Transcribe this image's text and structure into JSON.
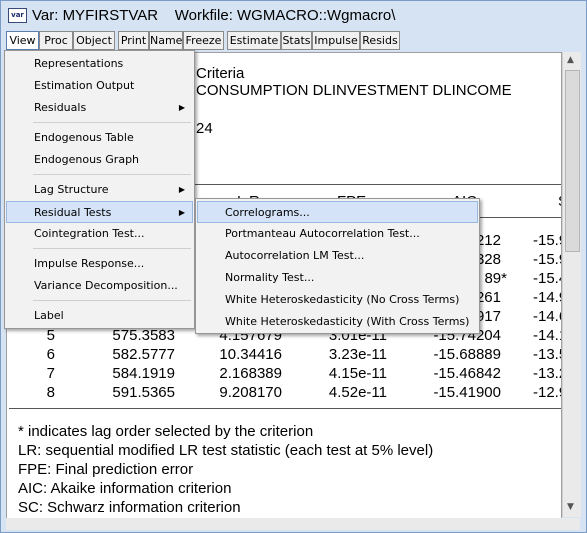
{
  "window": {
    "title": "Var: MYFIRSTVAR    Workfile: WGMACRO::Wgmacro\\",
    "icon_text": "var"
  },
  "toolbar": [
    "View",
    "Proc",
    "Object",
    "Print",
    "Name",
    "Freeze",
    "Estimate",
    "Stats",
    "Impulse",
    "Resids"
  ],
  "content": {
    "partial_lines": [
      "Criteria",
      "CONSUMPTION DLINVESTMENT DLINCOME",
      "24"
    ],
    "header_partial": [
      "L R",
      "FPE",
      "AIC",
      "S"
    ],
    "rows": [
      {
        "lag": "",
        "logl": "",
        "lr": "",
        "fpe": "",
        "aic": "212",
        "sc": "-15.9"
      },
      {
        "lag": "",
        "logl": "",
        "lr": "",
        "fpe": "",
        "aic": "328",
        "sc": "-15.9"
      },
      {
        "lag": "",
        "logl": "",
        "lr": "",
        "fpe": "",
        "aic": "89*",
        "sc": "-15.4"
      },
      {
        "lag": "",
        "logl": "",
        "lr": "",
        "fpe": "",
        "aic": "261",
        "sc": "-14.9"
      },
      {
        "lag": "",
        "logl": "",
        "lr": "",
        "fpe": "",
        "aic": "917",
        "sc": "-14.6"
      },
      {
        "lag": "5",
        "logl": "575.3583",
        "lr": "4.157679",
        "fpe": "3.01e-11",
        "aic": "-15.74204",
        "sc": "-14.1"
      },
      {
        "lag": "6",
        "logl": "582.5777",
        "lr": "10.34416",
        "fpe": "3.23e-11",
        "aic": "-15.68889",
        "sc": "-13.5"
      },
      {
        "lag": "7",
        "logl": "584.1919",
        "lr": "2.168389",
        "fpe": "4.15e-11",
        "aic": "-15.46842",
        "sc": "-13.2"
      },
      {
        "lag": "8",
        "logl": "591.5365",
        "lr": "9.208170",
        "fpe": "4.52e-11",
        "aic": "-15.41900",
        "sc": "-12.9"
      }
    ],
    "notes": [
      "* indicates lag order selected by the criterion",
      "LR: sequential modified LR test statistic (each test at 5% level)",
      "FPE: Final prediction error",
      "AIC: Akaike information criterion",
      "SC: Schwarz information criterion"
    ]
  },
  "menu": {
    "items": [
      "Representations",
      "Estimation Output",
      "Residuals",
      "Endogenous Table",
      "Endogenous Graph",
      "Lag Structure",
      "Residual Tests",
      "Cointegration Test...",
      "Impulse Response...",
      "Variance Decomposition...",
      "Label"
    ],
    "submenu_arrow": "▶"
  },
  "submenu": {
    "items": [
      "Correlograms...",
      "Portmanteau Autocorrelation Test...",
      "Autocorrelation LM Test...",
      "Normality Test...",
      "White Heteroskedasticity (No Cross Terms)",
      "White Heteroskedasticity (With Cross Terms)"
    ]
  },
  "scroll": {
    "up": "▲",
    "down": "▼"
  }
}
